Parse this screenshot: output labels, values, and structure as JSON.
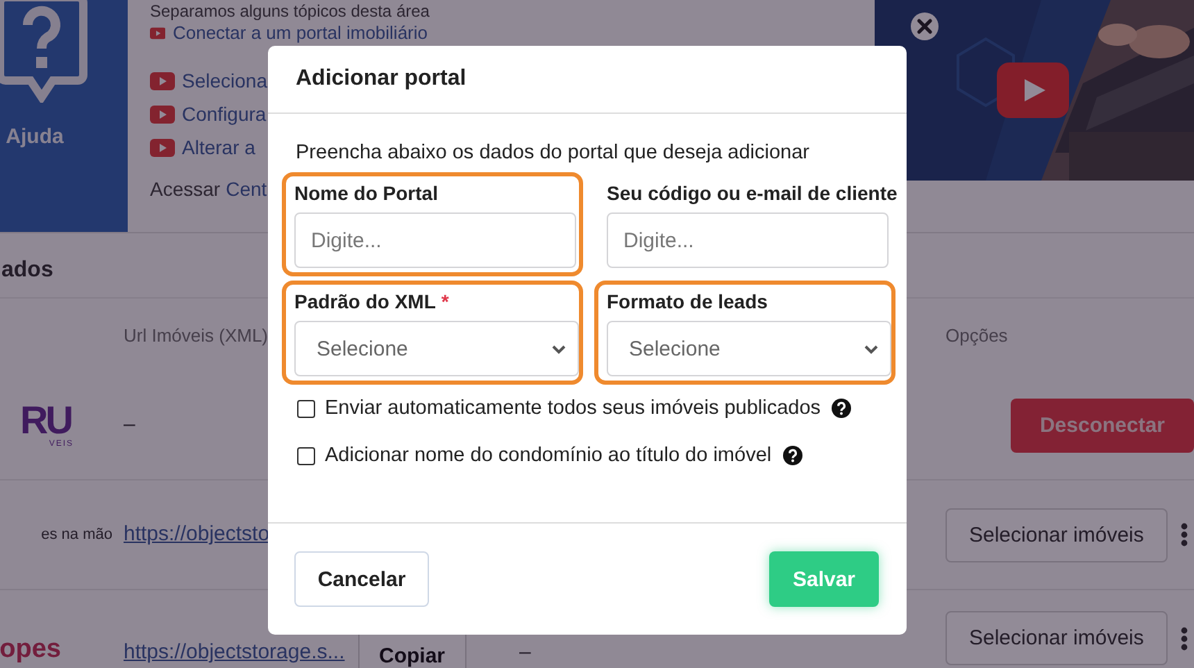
{
  "help": {
    "title": "Ajuda",
    "intro": "Separamos alguns tópicos desta área",
    "links": [
      {
        "label": "Conectar a um portal imobiliário"
      },
      {
        "label": "Seleciona"
      },
      {
        "label": "Configura"
      },
      {
        "label": "Alterar a"
      }
    ],
    "access_label": "Acessar",
    "access_link": "Cent"
  },
  "section_title": "ados",
  "table": {
    "columns": [
      "Url Imóveis (XML)",
      "Opções"
    ],
    "rows": [
      {
        "kind": "danger",
        "logo": "RU",
        "logo_sub": "VEIS",
        "url_text": "–",
        "action": "Desconectar",
        "menu": false
      },
      {
        "kind": "default",
        "logo": "es na mão",
        "url": "https://objectsto",
        "action": "Selecionar imóveis",
        "menu": true
      },
      {
        "kind": "default",
        "logo": "opes",
        "url": "https://objectstorage.s...",
        "copy": "Copiar",
        "extra": "–",
        "action": "Selecionar imóveis",
        "menu": true
      }
    ]
  },
  "modal": {
    "title": "Adicionar portal",
    "intro": "Preencha abaixo os dados do portal que deseja adicionar",
    "fields": [
      {
        "kind": "input",
        "label": "Nome do Portal",
        "placeholder": "Digite...",
        "highlighted": true
      },
      {
        "kind": "input",
        "label": "Seu código ou e-mail de cliente",
        "placeholder": "Digite...",
        "highlighted": false
      },
      {
        "kind": "select",
        "label": "Padrão do XML",
        "required_mark": "*",
        "placeholder": "Selecione",
        "highlighted": true
      },
      {
        "kind": "select",
        "label": "Formato de leads",
        "placeholder": "Selecione",
        "highlighted": true
      }
    ],
    "options": [
      {
        "label": "Enviar automaticamente todos seus imóveis publicados",
        "checked": false
      },
      {
        "label": "Adicionar nome do condomínio ao título do imóvel",
        "checked": false
      }
    ],
    "cancel": "Cancelar",
    "save": "Salvar"
  }
}
